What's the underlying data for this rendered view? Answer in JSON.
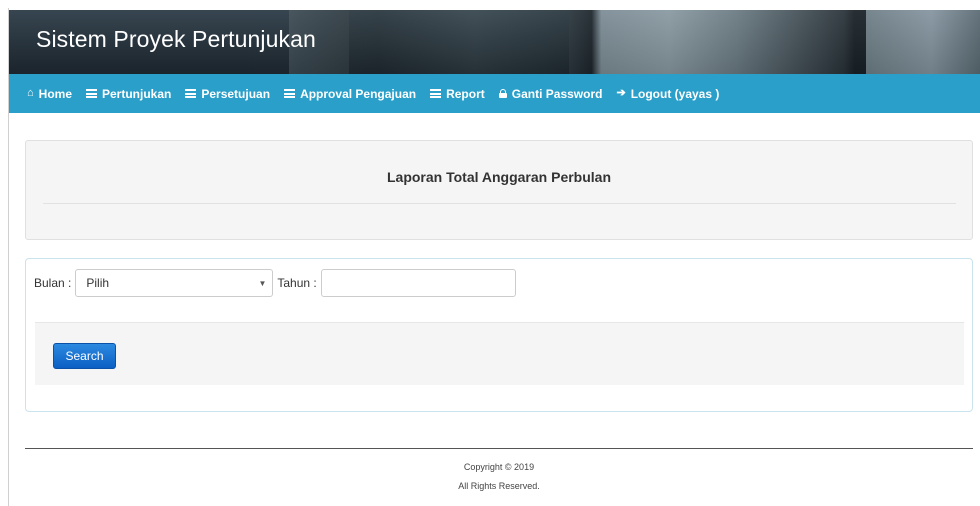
{
  "header": {
    "title": "Sistem Proyek Pertunjukan"
  },
  "nav": {
    "items": [
      {
        "label": "Home",
        "icon": "home-icon"
      },
      {
        "label": "Pertunjukan",
        "icon": "list-icon"
      },
      {
        "label": "Persetujuan",
        "icon": "list-icon"
      },
      {
        "label": "Approval Pengajuan",
        "icon": "list-icon"
      },
      {
        "label": "Report",
        "icon": "list-icon"
      },
      {
        "label": "Ganti Password",
        "icon": "lock-icon"
      },
      {
        "label": "Logout (yayas )",
        "icon": "logout-icon"
      }
    ]
  },
  "report": {
    "title": "Laporan Total Anggaran Perbulan"
  },
  "filter": {
    "bulan_label": "Bulan :",
    "bulan_value": "Pilih",
    "tahun_label": "Tahun :",
    "tahun_value": "",
    "search_label": "Search"
  },
  "footer": {
    "copyright": "Copyright © 2019",
    "rights": "All Rights Reserved."
  },
  "colors": {
    "navbar": "#2a9fc9",
    "button": "#0c5fc4",
    "panel": "#f5f5f5"
  }
}
